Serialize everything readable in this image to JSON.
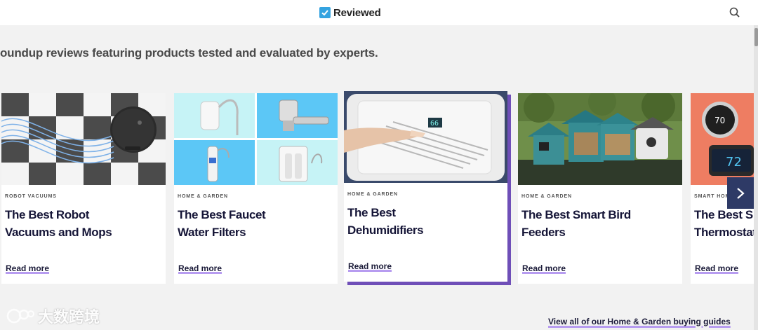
{
  "header": {
    "logo_text": "Reviewed"
  },
  "subtitle": "oundup reviews featuring products tested and evaluated by experts.",
  "cards": [
    {
      "category": "ROBOT VACUUMS",
      "title_line1": "The Best Robot",
      "title_line2": "Vacuums and Mops",
      "link": "Read more"
    },
    {
      "category": "HOME & GARDEN",
      "title_line1": "The Best Faucet",
      "title_line2": "Water Filters",
      "link": "Read more"
    },
    {
      "category": "HOME & GARDEN",
      "title_line1": "The Best",
      "title_line2": "Dehumidifiers",
      "link": "Read more"
    },
    {
      "category": "HOME & GARDEN",
      "title_line1": "The Best Smart Bird",
      "title_line2": "Feeders",
      "link": "Read more"
    },
    {
      "category": "SMART HOME",
      "title_line1": "The Best Sm",
      "title_line2": "Thermostats",
      "link": "Read more"
    }
  ],
  "thermostat": {
    "reading_1": "70",
    "reading_2": "72"
  },
  "dehumidifier_display": "66",
  "view_all": "View all of our Home & Garden buying guides",
  "watermark": "大数跨境",
  "colors": {
    "accent_purple": "#6f4fb8",
    "link_underline": "#b79cf0",
    "nav_button": "#2e3a66",
    "logo_blue": "#34a3e0"
  }
}
